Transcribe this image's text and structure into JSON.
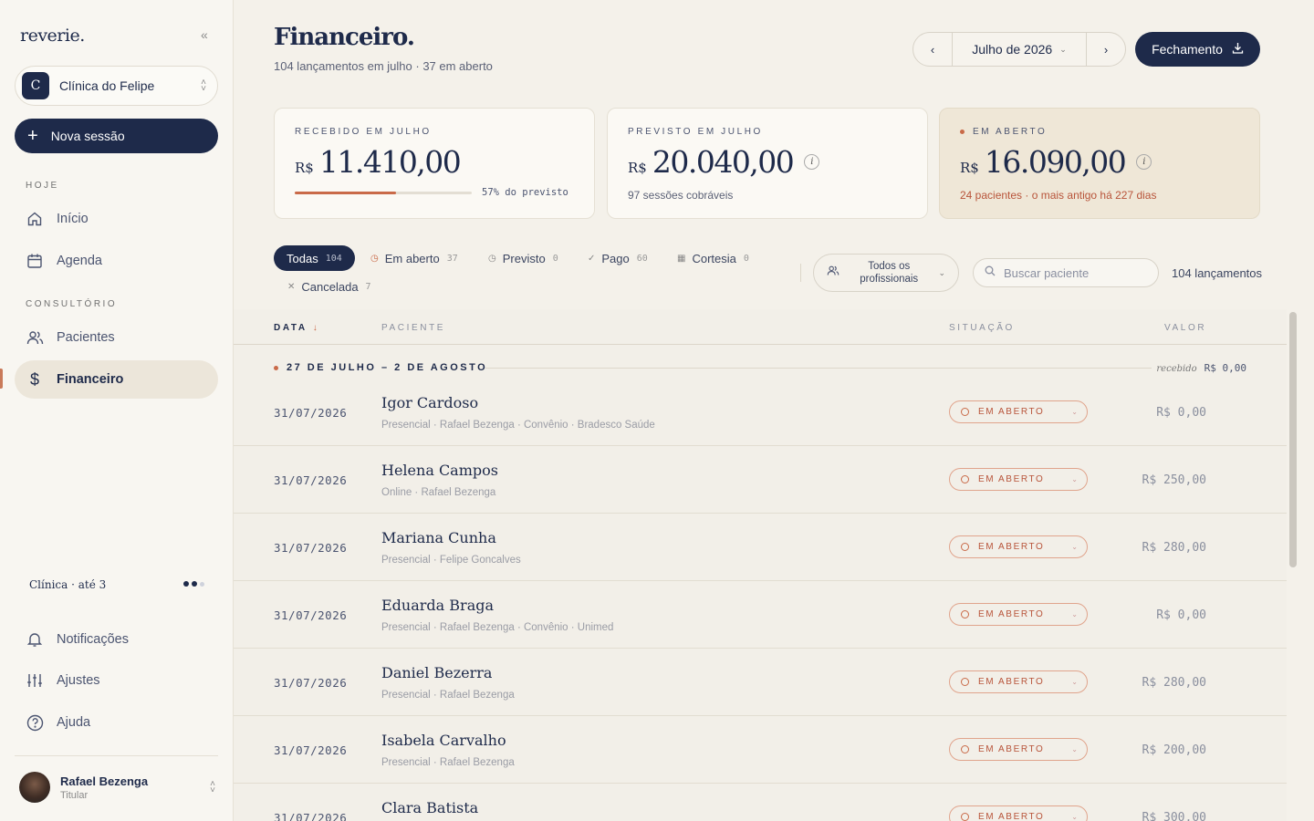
{
  "sidebar": {
    "logo": "reverie.",
    "clinic_initial": "C",
    "clinic_name": "Clínica do Felipe",
    "new_session": "Nova sessão",
    "section_today": "HOJE",
    "section_office": "CONSULTÓRIO",
    "items": [
      {
        "label": "Início",
        "icon": "home-icon"
      },
      {
        "label": "Agenda",
        "icon": "calendar-icon"
      },
      {
        "label": "Pacientes",
        "icon": "users-icon"
      },
      {
        "label": "Financeiro",
        "icon": "dollar-icon",
        "active": true
      }
    ],
    "plan": "Clínica · até 3",
    "bottom_items": [
      {
        "label": "Notificações",
        "icon": "bell-icon"
      },
      {
        "label": "Ajustes",
        "icon": "sliders-icon"
      },
      {
        "label": "Ajuda",
        "icon": "help-icon"
      }
    ],
    "user_name": "Rafael Bezenga",
    "user_role": "Titular"
  },
  "header": {
    "title": "Financeiro.",
    "subtitle": "104 lançamentos em julho · 37 em aberto",
    "month": "Julho de 2026",
    "close_button": "Fechamento"
  },
  "cards": {
    "received": {
      "label": "RECEBIDO EM JULHO",
      "currency": "R$",
      "amount": "11.410,00",
      "progress": 0.57,
      "progress_text": "57% do previsto"
    },
    "expected": {
      "label": "PREVISTO EM JULHO",
      "currency": "R$",
      "amount": "20.040,00",
      "note": "97 sessões cobráveis"
    },
    "open": {
      "label": "EM ABERTO",
      "currency": "R$",
      "amount": "16.090,00",
      "note": "24 pacientes · o mais antigo há 227 dias"
    }
  },
  "filters": {
    "chips": [
      {
        "label": "Todas",
        "count": "104",
        "icon": ""
      },
      {
        "label": "Em aberto",
        "count": "37",
        "icon": "clock-icon"
      },
      {
        "label": "Previsto",
        "count": "0",
        "icon": "clock-icon"
      },
      {
        "label": "Pago",
        "count": "60",
        "icon": "check-icon"
      },
      {
        "label": "Cortesia",
        "count": "0",
        "icon": "gift-icon"
      },
      {
        "label": "Cancelada",
        "count": "7",
        "icon": "x-icon"
      }
    ],
    "professional_line1": "Todos os",
    "professional_line2": "profissionais",
    "search_placeholder": "Buscar paciente",
    "total": "104 lançamentos"
  },
  "table": {
    "headers": {
      "date": "DATA",
      "patient": "PACIENTE",
      "status": "SITUAÇÃO",
      "value": "VALOR"
    },
    "week": {
      "label": "27 DE JULHO – 2 DE AGOSTO",
      "received_label": "recebido",
      "received_value": "R$ 0,00"
    },
    "rows": [
      {
        "date": "31/07/2026",
        "name": "Igor Cardoso",
        "meta": "Presencial · Rafael Bezenga · Convênio · Bradesco Saúde",
        "status": "EM ABERTO",
        "value": "R$ 0,00"
      },
      {
        "date": "31/07/2026",
        "name": "Helena Campos",
        "meta": "Online · Rafael Bezenga",
        "status": "EM ABERTO",
        "value": "R$ 250,00"
      },
      {
        "date": "31/07/2026",
        "name": "Mariana Cunha",
        "meta": "Presencial · Felipe Goncalves",
        "status": "EM ABERTO",
        "value": "R$ 280,00"
      },
      {
        "date": "31/07/2026",
        "name": "Eduarda Braga",
        "meta": "Presencial · Rafael Bezenga · Convênio · Unimed",
        "status": "EM ABERTO",
        "value": "R$ 0,00"
      },
      {
        "date": "31/07/2026",
        "name": "Daniel Bezerra",
        "meta": "Presencial · Rafael Bezenga",
        "status": "EM ABERTO",
        "value": "R$ 280,00"
      },
      {
        "date": "31/07/2026",
        "name": "Isabela Carvalho",
        "meta": "Presencial · Rafael Bezenga",
        "status": "EM ABERTO",
        "value": "R$ 200,00"
      },
      {
        "date": "31/07/2026",
        "name": "Clara Batista",
        "meta": "",
        "status": "EM ABERTO",
        "value": "R$ 300,00"
      }
    ]
  },
  "colors": {
    "navy": "#1e2a4a",
    "accent": "#c96a48",
    "background": "#f4f1ea"
  }
}
